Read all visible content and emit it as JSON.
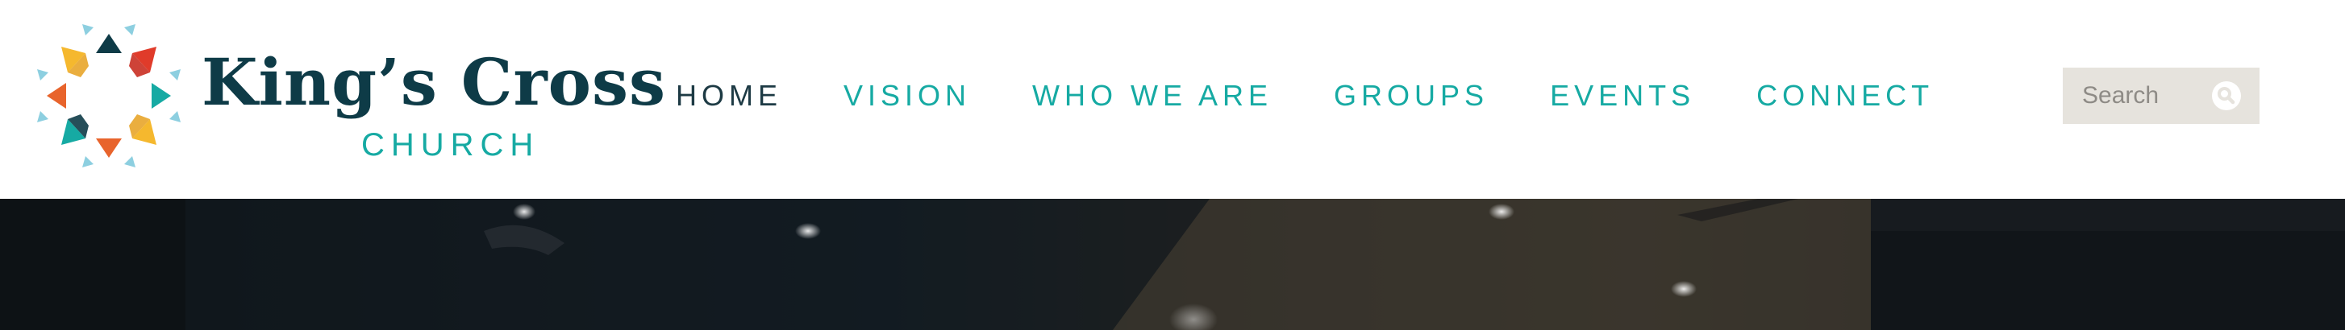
{
  "logo": {
    "title": "King’s Cross",
    "subtitle": "CHURCH",
    "mark": "starburst-logo-icon"
  },
  "nav": {
    "items": [
      {
        "label": "HOME",
        "active": true
      },
      {
        "label": "VISION",
        "active": false
      },
      {
        "label": "WHO WE ARE",
        "active": false
      },
      {
        "label": "GROUPS",
        "active": false
      },
      {
        "label": "EVENTS",
        "active": false
      },
      {
        "label": "CONNECT",
        "active": false
      }
    ]
  },
  "search": {
    "placeholder": "Search",
    "icon": "search-icon"
  },
  "colors": {
    "navy": "#0e3b47",
    "teal": "#16aaa3",
    "orange": "#e8642c",
    "yellow": "#f5b82e",
    "red": "#e03b2a",
    "light_blue": "#8dcfe0",
    "search_bg": "#e6e3dd"
  }
}
